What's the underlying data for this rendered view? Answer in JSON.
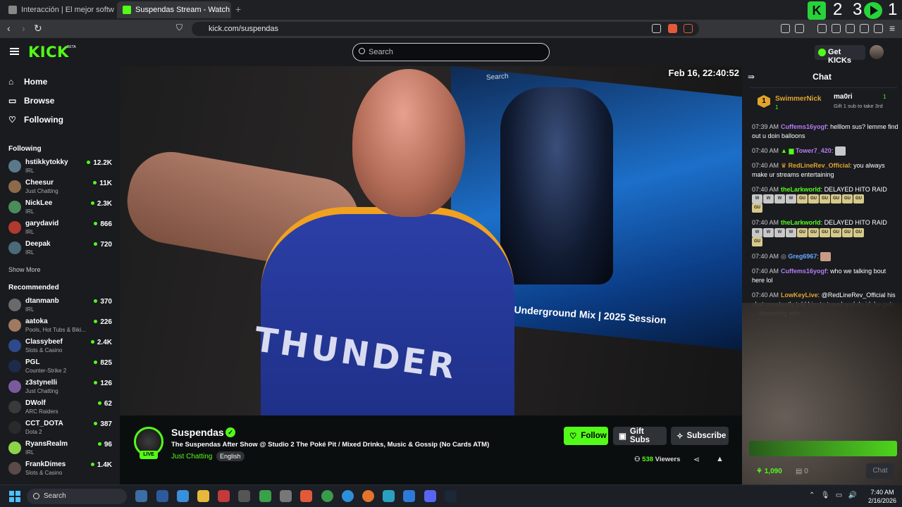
{
  "browser": {
    "tabs": [
      {
        "title": "Interacción | El mejor software para ...",
        "favicon_color": "#888888"
      },
      {
        "title": "Suspendas Stream - Watch Li...",
        "favicon_color": "#53fc18"
      }
    ],
    "url": "kick.com/suspendas",
    "overlay_count1": "2 3",
    "overlay_count2": "1"
  },
  "header": {
    "logo": "KICK",
    "logo_beta": "BETA",
    "search_placeholder": "Search",
    "get_kicks": "Get KICKs"
  },
  "sidebar": {
    "nav": [
      {
        "label": "Home",
        "icon": "home-icon"
      },
      {
        "label": "Browse",
        "icon": "browse-icon"
      },
      {
        "label": "Following",
        "icon": "heart-icon"
      }
    ],
    "following_title": "Following",
    "following": [
      {
        "name": "hstikkytokky",
        "category": "IRL",
        "viewers": "12.2K",
        "color": "#5a7a8c"
      },
      {
        "name": "Cheesur",
        "category": "Just Chatting",
        "viewers": "11K",
        "color": "#8c6a4a"
      },
      {
        "name": "NickLee",
        "category": "IRL",
        "viewers": "2.3K",
        "color": "#4a8c5a"
      },
      {
        "name": "garydavid",
        "category": "IRL",
        "viewers": "866",
        "color": "#b03a2e"
      },
      {
        "name": "Deepak",
        "category": "IRL",
        "viewers": "720",
        "color": "#4a6a7a"
      }
    ],
    "show_more": "Show More",
    "recommended_title": "Recommended",
    "recommended": [
      {
        "name": "dtanmanb",
        "category": "IRL",
        "viewers": "370",
        "color": "#6a6a6a"
      },
      {
        "name": "aatoka",
        "category": "Pools, Hot Tubs & Biki...",
        "viewers": "226",
        "color": "#a07a60"
      },
      {
        "name": "Classybeef",
        "category": "Slots & Casino",
        "viewers": "2.4K",
        "color": "#2e4a8c"
      },
      {
        "name": "PGL",
        "category": "Counter-Strike 2",
        "viewers": "825",
        "color": "#1e2a4a"
      },
      {
        "name": "z3stynelli",
        "category": "Just Chatting",
        "viewers": "126",
        "color": "#7a5a9c"
      },
      {
        "name": "DWolf",
        "category": "ARC Raiders",
        "viewers": "62",
        "color": "#3a3a3a"
      },
      {
        "name": "CCT_DOTA",
        "category": "Dota 2",
        "viewers": "387",
        "color": "#2a2a2a"
      },
      {
        "name": "RyansRealm",
        "category": "IRL",
        "viewers": "96",
        "color": "#8cd44a"
      },
      {
        "name": "FrankDimes",
        "category": "Slots & Casino",
        "viewers": "1.4K",
        "color": "#5a4a4a"
      }
    ]
  },
  "video": {
    "timestamp": "Feb 16, 22:40:52",
    "screen_caption": "tic Underground Mix | 2025 Session",
    "screen_search": "Search",
    "jersey_text": "THUNDER"
  },
  "stream": {
    "live": "LIVE",
    "streamer": "Suspendas",
    "title": "The Suspendas After Show @ Studio 2 The Poké Pit / Mixed Drinks, Music & Gossip (No Cards ATM)",
    "category": "Just Chatting",
    "language": "English",
    "follow": "Follow",
    "gift_subs": "Gift Subs",
    "subscribe": "Subscribe",
    "viewer_count": "538",
    "viewers_label": "Viewers"
  },
  "chat": {
    "title": "Chat",
    "pinned": {
      "rank": "1",
      "user1": "SwimmerNick",
      "user1_count": "1",
      "user2": "ma0ri",
      "user2_count": "1",
      "gift_text": "Gift 1 sub to take 3rd"
    },
    "messages": [
      {
        "time": "07:39 AM",
        "user": "Cuffems16yogf",
        "color": "#b57cf2",
        "text": "helllom sus? lemme find out u doin balloons"
      },
      {
        "time": "07:40 AM",
        "user": "Tower7_420",
        "color": "#b57cf2",
        "text": ""
      },
      {
        "time": "07:40 AM",
        "user": "RedLineRev_Official",
        "color": "#e2a42c",
        "text": "you always make ur streams entertaining"
      },
      {
        "time": "07:40 AM",
        "user": "theLarkworld",
        "color": "#53fc18",
        "text": "DELAYED HITO RAID"
      },
      {
        "time": "07:40 AM",
        "user": "theLarkworld",
        "color": "#53fc18",
        "text": "DELAYED HITO RAID"
      },
      {
        "time": "07:40 AM",
        "user": "Greg6967",
        "color": "#6aa8ff",
        "text": ""
      },
      {
        "time": "07:40 AM",
        "user": "Cuffems16yogf",
        "color": "#b57cf2",
        "text": "who we talking bout here lol"
      },
      {
        "time": "07:40 AM",
        "user": "LowKeyLive",
        "color": "#e2a42c",
        "text": "@RedLineRev_Official his chat constantly told him to travel and do irl; he gets ... streaming with"
      }
    ],
    "kicks": "1,090",
    "zero": "0",
    "chat_button": "Chat"
  },
  "taskbar": {
    "search": "Search",
    "time": "7:40 AM",
    "date": "2/16/2026"
  }
}
